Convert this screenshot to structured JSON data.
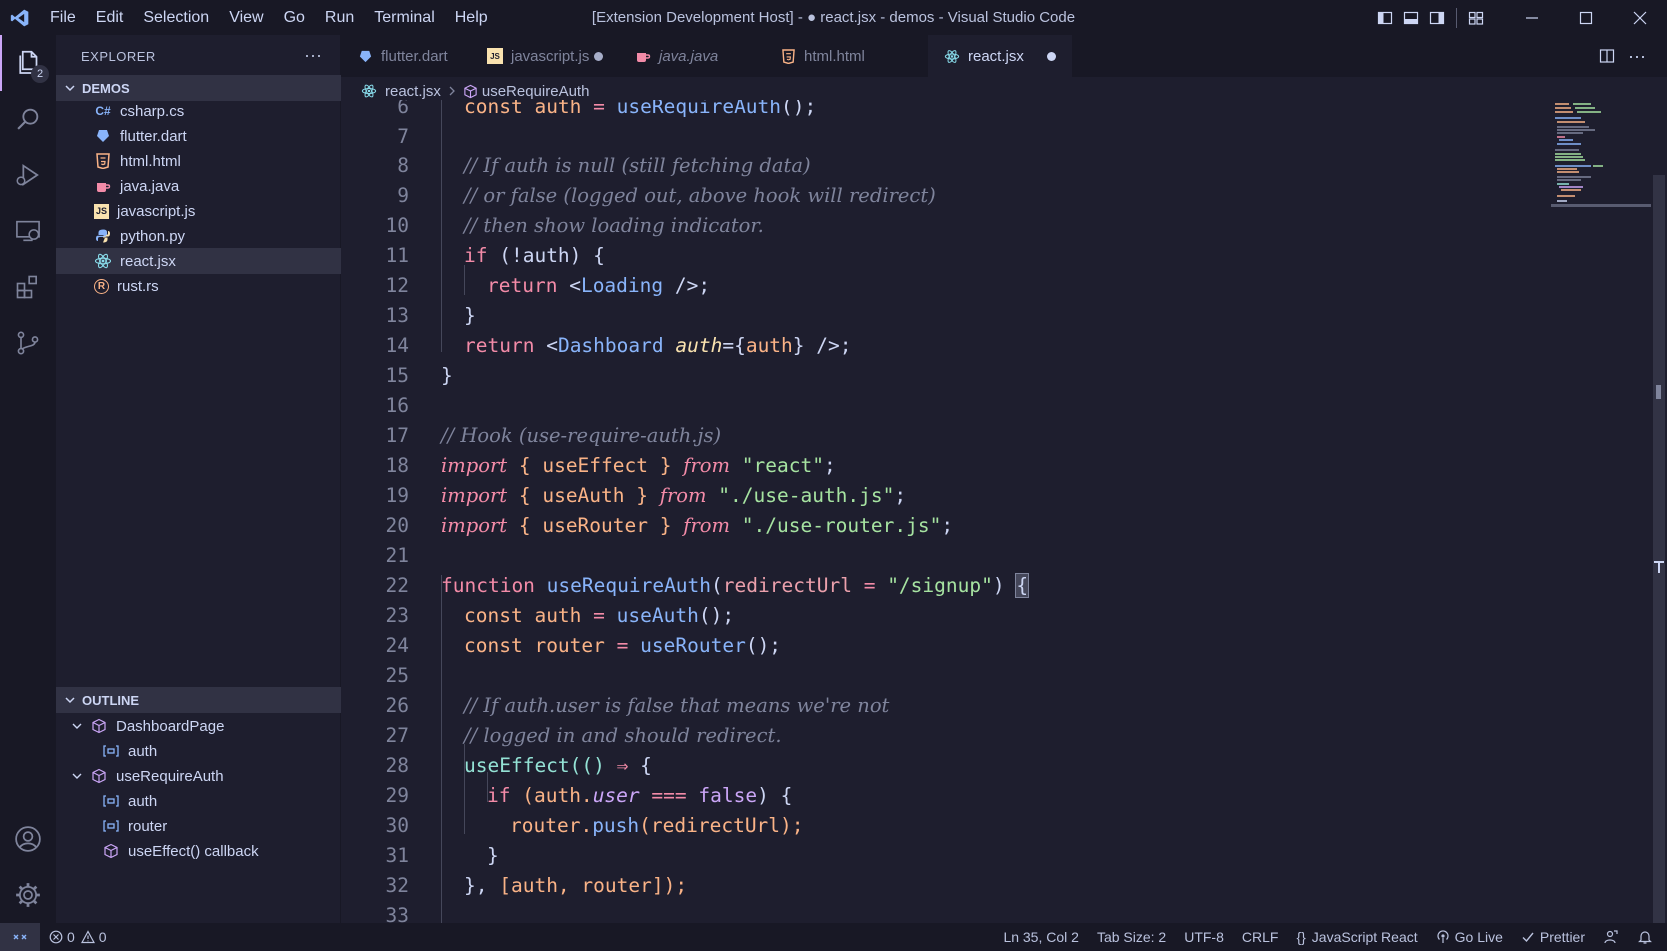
{
  "titlebar": {
    "menus": [
      "File",
      "Edit",
      "Selection",
      "View",
      "Go",
      "Run",
      "Terminal",
      "Help"
    ],
    "title": "[Extension Development Host] - ● react.jsx - demos - Visual Studio Code"
  },
  "activitybar": {
    "explorer_badge": "2"
  },
  "sidebar": {
    "title": "EXPLORER",
    "more": "···",
    "folder": "DEMOS",
    "files": [
      {
        "name": "csharp.cs",
        "icon": "C#",
        "color": "#89b4fa"
      },
      {
        "name": "flutter.dart",
        "icon": "dart-icon",
        "color": "#89b4fa"
      },
      {
        "name": "html.html",
        "icon": "html-icon",
        "color": "#fab387"
      },
      {
        "name": "java.java",
        "icon": "java-icon",
        "color": "#f38ba8"
      },
      {
        "name": "javascript.js",
        "icon": "JS",
        "color": "#f9e2af"
      },
      {
        "name": "python.py",
        "icon": "python-icon",
        "color": "#89b4fa"
      },
      {
        "name": "react.jsx",
        "icon": "react-icon",
        "color": "#89dceb"
      },
      {
        "name": "rust.rs",
        "icon": "R",
        "color": "#fab387"
      }
    ],
    "outline_title": "OUTLINE",
    "outline": [
      {
        "name": "DashboardPage",
        "kind": "module"
      },
      {
        "name": "auth",
        "kind": "variable"
      },
      {
        "name": "useRequireAuth",
        "kind": "module"
      },
      {
        "name": "auth",
        "kind": "variable"
      },
      {
        "name": "router",
        "kind": "variable"
      },
      {
        "name": "useEffect() callback",
        "kind": "module"
      }
    ]
  },
  "tabs": [
    {
      "label": "flutter.dart",
      "dirty": false
    },
    {
      "label": "javascript.js",
      "dirty": true
    },
    {
      "label": "java.java",
      "dirty": false
    },
    {
      "label": "html.html",
      "dirty": false
    },
    {
      "label": "react.jsx",
      "dirty": true
    }
  ],
  "breadcrumb": {
    "file": "react.jsx",
    "symbol": "useRequireAuth"
  },
  "code_lines": [
    "6",
    "7",
    "8",
    "9",
    "10",
    "11",
    "12",
    "13",
    "14",
    "15",
    "16",
    "17",
    "18",
    "19",
    "20",
    "21",
    "22",
    "23",
    "24",
    "25",
    "26",
    "27",
    "28",
    "29",
    "30",
    "31",
    "32",
    "33"
  ],
  "code": {
    "l6": [
      "const",
      "auth",
      "=",
      "useRequireAuth",
      "();"
    ],
    "l8": "// If auth is null (still fetching data)",
    "l9": "// or false (logged out, above hook will redirect)",
    "l10": "// then show loading indicator.",
    "l11": [
      "if",
      "(!auth) {"
    ],
    "l12": [
      "return",
      "<",
      "Loading",
      "/>;"
    ],
    "l13": "}",
    "l14": [
      "return",
      "<",
      "Dashboard",
      "auth",
      "={",
      "auth",
      "}",
      "/>;"
    ],
    "l15": "}",
    "l17": "// Hook (use-require-auth.js)",
    "l18": [
      "import",
      "{ useEffect }",
      "from",
      "\"react\"",
      ";"
    ],
    "l19": [
      "import",
      "{ useAuth }",
      "from",
      "\"./use-auth.js\"",
      ";"
    ],
    "l20": [
      "import",
      "{ useRouter }",
      "from",
      "\"./use-router.js\"",
      ";"
    ],
    "l22": [
      "function",
      "useRequireAuth",
      "(",
      "redirectUrl",
      "=",
      "\"/signup\"",
      ")",
      "{"
    ],
    "l23": [
      "const",
      "auth",
      "=",
      "useAuth",
      "();"
    ],
    "l24": [
      "const",
      "router",
      "=",
      "useRouter",
      "();"
    ],
    "l26": "// If auth.user is false that means we're not",
    "l27": "// logged in and should redirect.",
    "l28": [
      "useEffect",
      "(()",
      "⇒",
      "{"
    ],
    "l29": [
      "if",
      "(auth.",
      "user",
      "===",
      "false",
      ") {"
    ],
    "l30": [
      "router.",
      "push",
      "(redirectUrl);"
    ],
    "l31": "}",
    "l32": [
      "},",
      "[auth, router]);"
    ]
  },
  "statusbar": {
    "errors": "0",
    "warnings": "0",
    "position": "Ln 35, Col 2",
    "tab_size": "Tab Size: 2",
    "encoding": "UTF-8",
    "eol": "CRLF",
    "language": "JavaScript React",
    "go_live": "Go Live",
    "prettier": "Prettier"
  },
  "colors": {
    "accent": "#cba6f7",
    "background": "#1e1e2e",
    "mantle": "#181825"
  }
}
